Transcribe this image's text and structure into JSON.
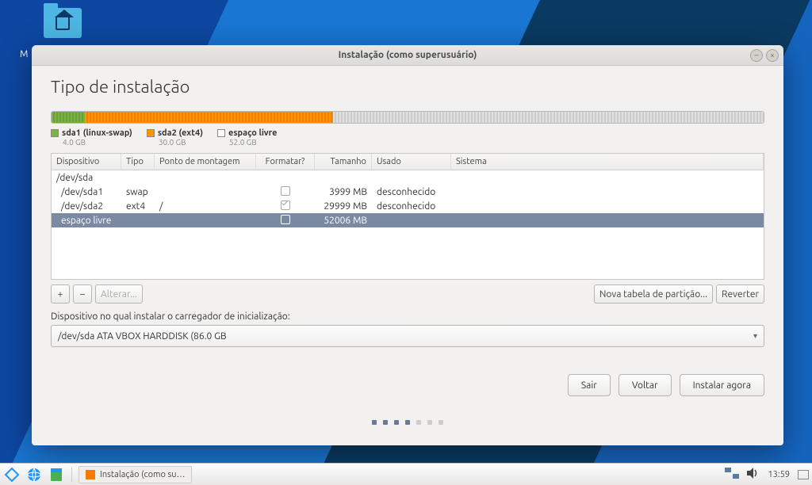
{
  "desktop": {
    "partial_label": "M"
  },
  "window": {
    "title": "Instalação (como superusuário)",
    "page_title": "Tipo de instalação"
  },
  "diskbar": {
    "segments": [
      {
        "class": "green",
        "width": "4.65%"
      },
      {
        "class": "orange",
        "width": "34.88%"
      },
      {
        "class": "gray",
        "width": "60.47%"
      }
    ]
  },
  "legend": [
    {
      "swatch": "green",
      "label": "sda1 (linux-swap)",
      "sub": "4.0 GB"
    },
    {
      "swatch": "orange",
      "label": "sda2 (ext4)",
      "sub": "30.0 GB"
    },
    {
      "swatch": "gray",
      "label": "espaço livre",
      "sub": "52.0 GB"
    }
  ],
  "table": {
    "headers": {
      "device": "Dispositivo",
      "type": "Tipo",
      "mount": "Ponto de montagem",
      "format": "Formatar?",
      "size": "Tamanho",
      "used": "Usado",
      "system": "Sistema"
    },
    "rows": [
      {
        "device": "/dev/sda",
        "type": "",
        "mount": "",
        "format": null,
        "size": "",
        "used": "",
        "system": "",
        "selected": false
      },
      {
        "device": "/dev/sda1",
        "type": "swap",
        "mount": "",
        "format": false,
        "size": "3999 MB",
        "used": "desconhecido",
        "system": "",
        "selected": false
      },
      {
        "device": "/dev/sda2",
        "type": "ext4",
        "mount": "/",
        "format": true,
        "size": "29999 MB",
        "used": "desconhecido",
        "system": "",
        "selected": false
      },
      {
        "device": "espaço livre",
        "type": "",
        "mount": "",
        "format": false,
        "size": "52006 MB",
        "used": "",
        "system": "",
        "selected": true
      }
    ]
  },
  "toolbar": {
    "add": "+",
    "remove": "–",
    "change": "Alterar...",
    "new_table": "Nova tabela de partição...",
    "revert": "Reverter"
  },
  "bootloader": {
    "label": "Dispositivo no qual instalar o carregador de inicialização:",
    "value": "/dev/sda   ATA VBOX HARDDISK (86.0 GB"
  },
  "footer": {
    "quit": "Sair",
    "back": "Voltar",
    "install": "Instalar agora"
  },
  "pager": {
    "total": 7,
    "active": [
      0,
      1,
      2,
      3
    ]
  },
  "taskbar": {
    "entry": "Instalação (como su…",
    "time": "13:59"
  }
}
